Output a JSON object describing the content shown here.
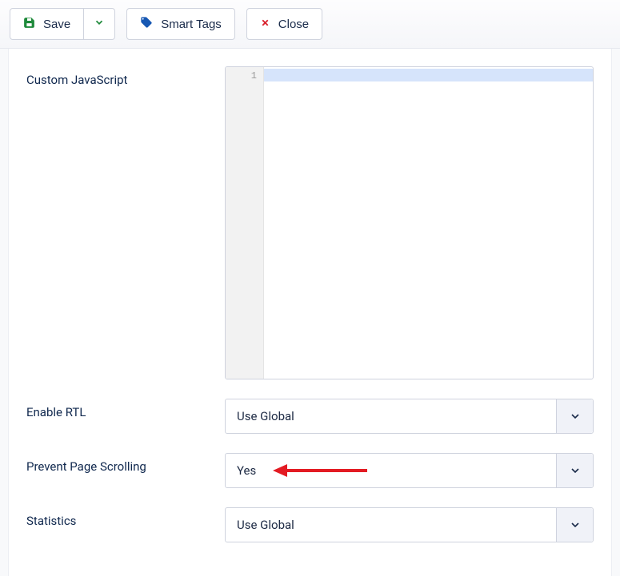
{
  "toolbar": {
    "save_label": "Save",
    "smart_tags_label": "Smart Tags",
    "close_label": "Close"
  },
  "fields": {
    "custom_js_label": "Custom JavaScript",
    "code_gutter_line": "1",
    "enable_rtl_label": "Enable RTL",
    "enable_rtl_value": "Use Global",
    "prevent_scroll_label": "Prevent Page Scrolling",
    "prevent_scroll_value": "Yes",
    "statistics_label": "Statistics",
    "statistics_value": "Use Global"
  }
}
